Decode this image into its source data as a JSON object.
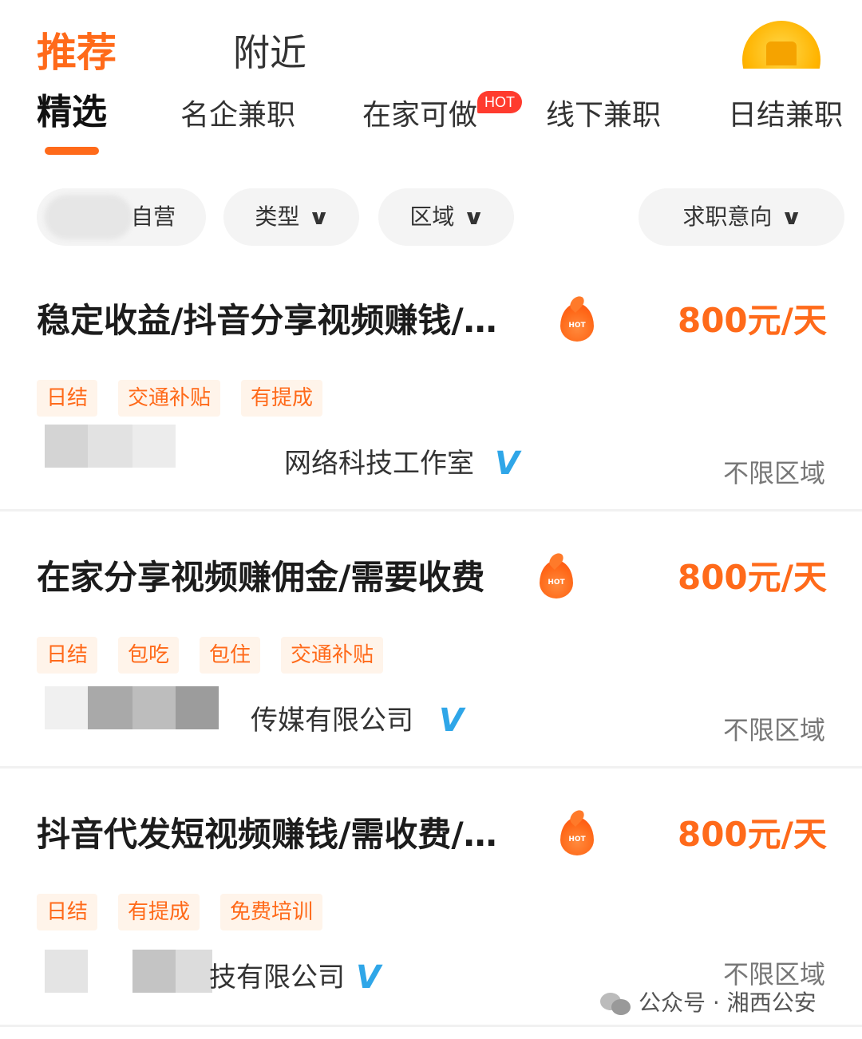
{
  "header": {
    "tabs": [
      {
        "label": "推荐",
        "active": true
      },
      {
        "label": "附近",
        "active": false
      }
    ],
    "avatar_icon": "coin-cat-icon"
  },
  "subtabs": [
    {
      "label": "精选",
      "active": true
    },
    {
      "label": "名企兼职",
      "active": false
    },
    {
      "label": "在家可做",
      "active": false,
      "badge": "HOT"
    },
    {
      "label": "线下兼职",
      "active": false
    },
    {
      "label": "日结兼职",
      "active": false
    }
  ],
  "filters": [
    {
      "label": "自营",
      "has_dropdown": false
    },
    {
      "label": "类型",
      "has_dropdown": true
    },
    {
      "label": "区域",
      "has_dropdown": true
    },
    {
      "label": "求职意向",
      "has_dropdown": true
    }
  ],
  "jobs": [
    {
      "title": "稳定收益/抖音分享视频赚钱/…",
      "salary": "800元/天",
      "hot_icon_text": "HOT",
      "tags": [
        "日结",
        "交通补贴",
        "有提成"
      ],
      "company": "网络科技工作室",
      "verified": "V",
      "area": "不限区域"
    },
    {
      "title": "在家分享视频赚佣金/需要收费",
      "salary": "800元/天",
      "hot_icon_text": "HOT",
      "tags": [
        "日结",
        "包吃",
        "包住",
        "交通补贴"
      ],
      "company": "传媒有限公司",
      "verified": "V",
      "area": "不限区域"
    },
    {
      "title": "抖音代发短视频赚钱/需收费/…",
      "salary": "800元/天",
      "hot_icon_text": "HOT",
      "tags": [
        "日结",
        "有提成",
        "免费培训"
      ],
      "company": "技有限公司",
      "verified": "V",
      "area": "不限区域"
    }
  ],
  "watermark": {
    "text": "公众号 · 湘西公安",
    "icon": "wechat-icon"
  },
  "colors": {
    "accent": "#ff6a1a",
    "hot_badge": "#ff3b2e",
    "verified": "#2fa6e8",
    "tag_bg": "#fff4ea"
  }
}
